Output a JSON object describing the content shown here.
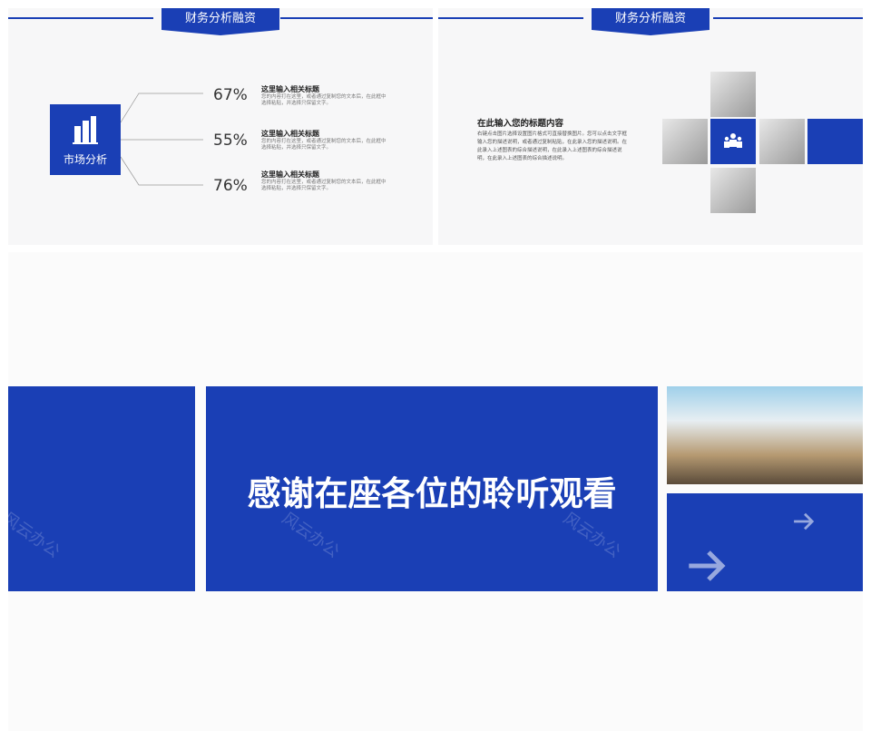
{
  "slide1": {
    "header": "财务分析融资",
    "center_label": "市场分析",
    "items": [
      {
        "percent": "67%",
        "title": "这里输入相关标题",
        "desc_line1": "您的内容打在这里，或者通过复制您的文本后，在此框中",
        "desc_line2": "选择粘贴，并选择只保留文字。"
      },
      {
        "percent": "55%",
        "title": "这里输入相关标题",
        "desc_line1": "您的内容打在这里，或者通过复制您的文本后，在此框中",
        "desc_line2": "选择粘贴，并选择只保留文字。"
      },
      {
        "percent": "76%",
        "title": "这里输入相关标题",
        "desc_line1": "您的内容打在这里，或者通过复制您的文本后，在此框中",
        "desc_line2": "选择粘贴，并选择只保留文字。"
      }
    ]
  },
  "slide2": {
    "header": "财务分析融资",
    "title": "在此输入您的标题内容",
    "body": [
      "右键点击图片选择设置图片格式可直接替换图片。您可以点击文字框",
      "输入您的描述说明，或者通过复制粘贴，在此录入您的描述说明。在",
      "此录入上述图表的综合描述说明，在此录入上述图表的综合描述说",
      "明，在此录入上述图表的综合描述说明。"
    ]
  },
  "slide3": {
    "thanks": "感谢在座各位的聆听观看",
    "watermark": "风云办公"
  },
  "colors": {
    "brand": "#1a3fb5"
  }
}
